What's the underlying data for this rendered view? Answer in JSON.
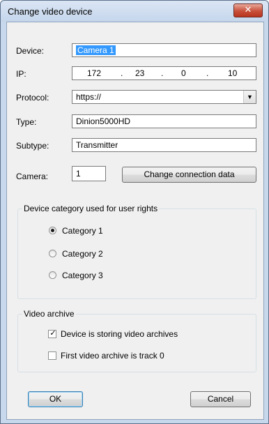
{
  "window": {
    "title": "Change video device",
    "close_glyph": "✕"
  },
  "fields": {
    "device_label": "Device:",
    "device_value": "Camera 1",
    "ip_label": "IP:",
    "ip_octets": [
      "172",
      "23",
      "0",
      "10"
    ],
    "ip_dot": ".",
    "protocol_label": "Protocol:",
    "protocol_value": "https://",
    "type_label": "Type:",
    "type_value": "Dinion5000HD",
    "subtype_label": "Subtype:",
    "subtype_value": "Transmitter",
    "camera_label": "Camera:",
    "camera_value": "1"
  },
  "buttons": {
    "change_connection": "Change connection data",
    "ok": "OK",
    "cancel": "Cancel"
  },
  "category_group": {
    "title": "Device category used for user rights",
    "options": [
      "Category 1",
      "Category 2",
      "Category 3"
    ],
    "selected_index": 0
  },
  "archive_group": {
    "title": "Video archive",
    "storing_label": "Device is storing video archives",
    "storing_checked": true,
    "track0_label": "First video archive is track 0",
    "track0_checked": false
  },
  "icons": {
    "combo_arrow": "arrow-down-icon",
    "close": "close-icon",
    "check": "checkmark-icon"
  },
  "colors": {
    "selection": "#3399ff",
    "close_button": "#c8503a",
    "title_bar": "#c8d8ec"
  }
}
